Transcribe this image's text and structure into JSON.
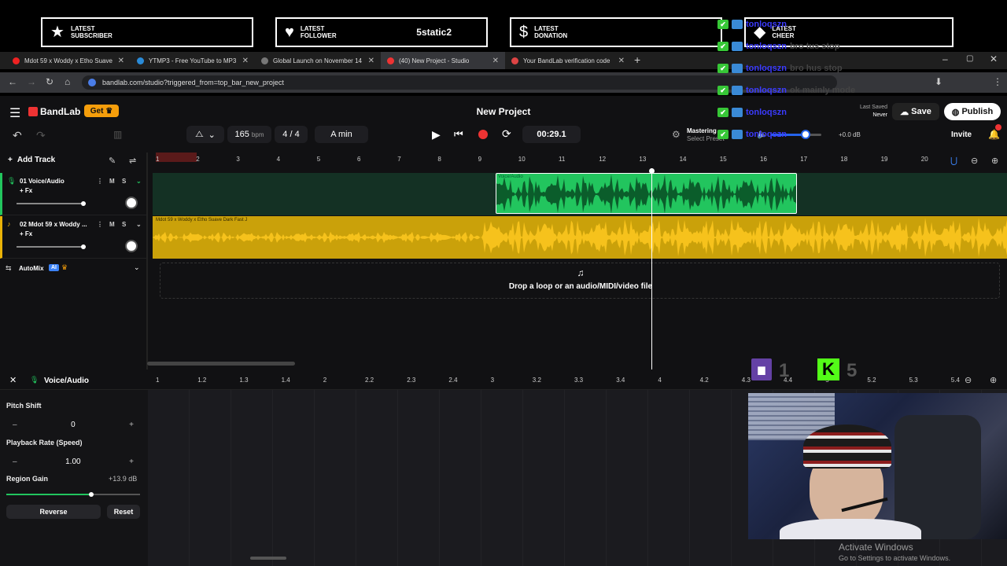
{
  "overlay": {
    "alerts": [
      {
        "label_line1": "LATEST",
        "label_line2": "SUBSCRIBER",
        "value": "",
        "icon": "star-icon",
        "glyph": "★"
      },
      {
        "label_line1": "LATEST",
        "label_line2": "FOLLOWER",
        "value": "5static2",
        "icon": "heart-icon",
        "glyph": "♥"
      },
      {
        "label_line1": "LATEST",
        "label_line2": "DONATION",
        "value": "",
        "icon": "dollar-icon",
        "glyph": "$"
      },
      {
        "label_line1": "LATEST",
        "label_line2": "CHEER",
        "value": "",
        "icon": "diamond-icon",
        "glyph": "◆"
      }
    ],
    "chat": [
      {
        "name": "tonloqszn",
        "msg": ""
      },
      {
        "name": "tonloqszn",
        "msg": "bro tus stop"
      },
      {
        "name": "tonloqszn",
        "msg": "bro hus stop"
      },
      {
        "name": "tonloqszn",
        "msg": "ok mainly mode"
      },
      {
        "name": "tonloqszn",
        "msg": ""
      },
      {
        "name": "tonloqszn",
        "msg": ""
      }
    ],
    "stats": {
      "twitch_count": "1",
      "kick_count": "5"
    },
    "watermark": {
      "title": "Activate Windows",
      "subtitle": "Go to Settings to activate Windows."
    }
  },
  "browser": {
    "tabs": [
      {
        "title": "Mdot 59 x Woddy x Etho Suave",
        "color": "#e22"
      },
      {
        "title": "YTMP3 - Free YouTube to MP3",
        "color": "#2a8bd8"
      },
      {
        "title": "Global Launch on November 14",
        "color": "#777"
      },
      {
        "title": "(40) New Project - Studio",
        "color": "#e33"
      },
      {
        "title": "Your BandLab verification code",
        "color": "#d44"
      }
    ],
    "url": "bandlab.com/studio?triggered_from=top_bar_new_project"
  },
  "app": {
    "brand": "BandLab",
    "get_label": "Get",
    "project_title": "New Project",
    "last_saved_label": "Last Saved",
    "last_saved_value": "Never",
    "save_label": "Save",
    "publish_label": "Publish",
    "invite_label": "Invite",
    "bpm_value": "165",
    "bpm_unit": "bpm",
    "time_sig_top": "4",
    "time_sig_sep": "/",
    "time_sig_bottom": "4",
    "key": "A min",
    "time_display": "00:29.1",
    "mastering_label": "Mastering",
    "mastering_preset": "Select Preset",
    "master_gain": "+0.0 dB",
    "add_track_label": "Add Track",
    "drop_hint": "Drop a loop or an audio/MIDI/video file",
    "automix_label": "AutoMix",
    "ai_badge": "AI"
  },
  "ruler_marks": [
    "1",
    "2",
    "3",
    "4",
    "5",
    "6",
    "7",
    "8",
    "9",
    "10",
    "11",
    "12",
    "13",
    "14",
    "15",
    "16",
    "17",
    "18",
    "19",
    "20"
  ],
  "tracks": [
    {
      "name": "01  Voice/Audio",
      "fx": "+ Fx",
      "m": "M",
      "s": "S",
      "region_label": "Voice/Audio",
      "color": "#22c55e"
    },
    {
      "name": "02  Mdot 59 x Woddy ...",
      "fx": "+ Fx",
      "m": "M",
      "s": "S",
      "region_label": "Mdot 59 x Woddy x Etho Suave Dark Fast J",
      "color": "#eab308"
    }
  ],
  "editor": {
    "title": "Voice/Audio",
    "ruler_marks": [
      "1",
      "1.2",
      "1.3",
      "1.4",
      "2",
      "2.2",
      "2.3",
      "2.4",
      "3",
      "3.2",
      "3.3",
      "3.4",
      "4",
      "4.2",
      "4.3",
      "4.4",
      "5",
      "5.2",
      "5.3",
      "5.4"
    ],
    "pitch_label": "Pitch Shift",
    "pitch_value": "0",
    "rate_label": "Playback Rate (Speed)",
    "rate_value": "1.00",
    "gain_label": "Region Gain",
    "gain_value": "+13.9 dB",
    "reverse_label": "Reverse",
    "reset_label": "Reset"
  }
}
